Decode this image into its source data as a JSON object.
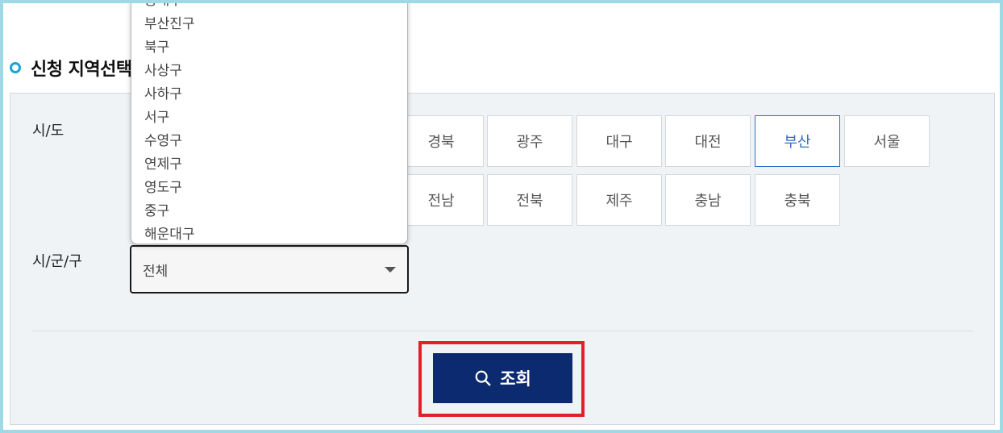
{
  "section": {
    "title": "신청 지역선택"
  },
  "labels": {
    "sido": "시/도",
    "sigungu": "시/군/구"
  },
  "sido_buttons": [
    {
      "label": "경북",
      "selected": false
    },
    {
      "label": "광주",
      "selected": false
    },
    {
      "label": "대구",
      "selected": false
    },
    {
      "label": "대전",
      "selected": false
    },
    {
      "label": "부산",
      "selected": true
    },
    {
      "label": "서울",
      "selected": false
    },
    {
      "label": "전남",
      "selected": false
    },
    {
      "label": "전북",
      "selected": false
    },
    {
      "label": "제주",
      "selected": false
    },
    {
      "label": "충남",
      "selected": false
    },
    {
      "label": "충북",
      "selected": false
    }
  ],
  "sigungu_select": {
    "value": "전체"
  },
  "dropdown_options": [
    "동래구",
    "부산진구",
    "북구",
    "사상구",
    "사하구",
    "서구",
    "수영구",
    "연제구",
    "영도구",
    "중구",
    "해운대구"
  ],
  "search_button": {
    "label": "조회",
    "icon": "search-icon"
  },
  "colors": {
    "selected_accent": "#2f6fbf",
    "search_button_bg": "#0b2a6f",
    "highlight": "#e3202a",
    "title_dot": "#1aa3d4"
  }
}
